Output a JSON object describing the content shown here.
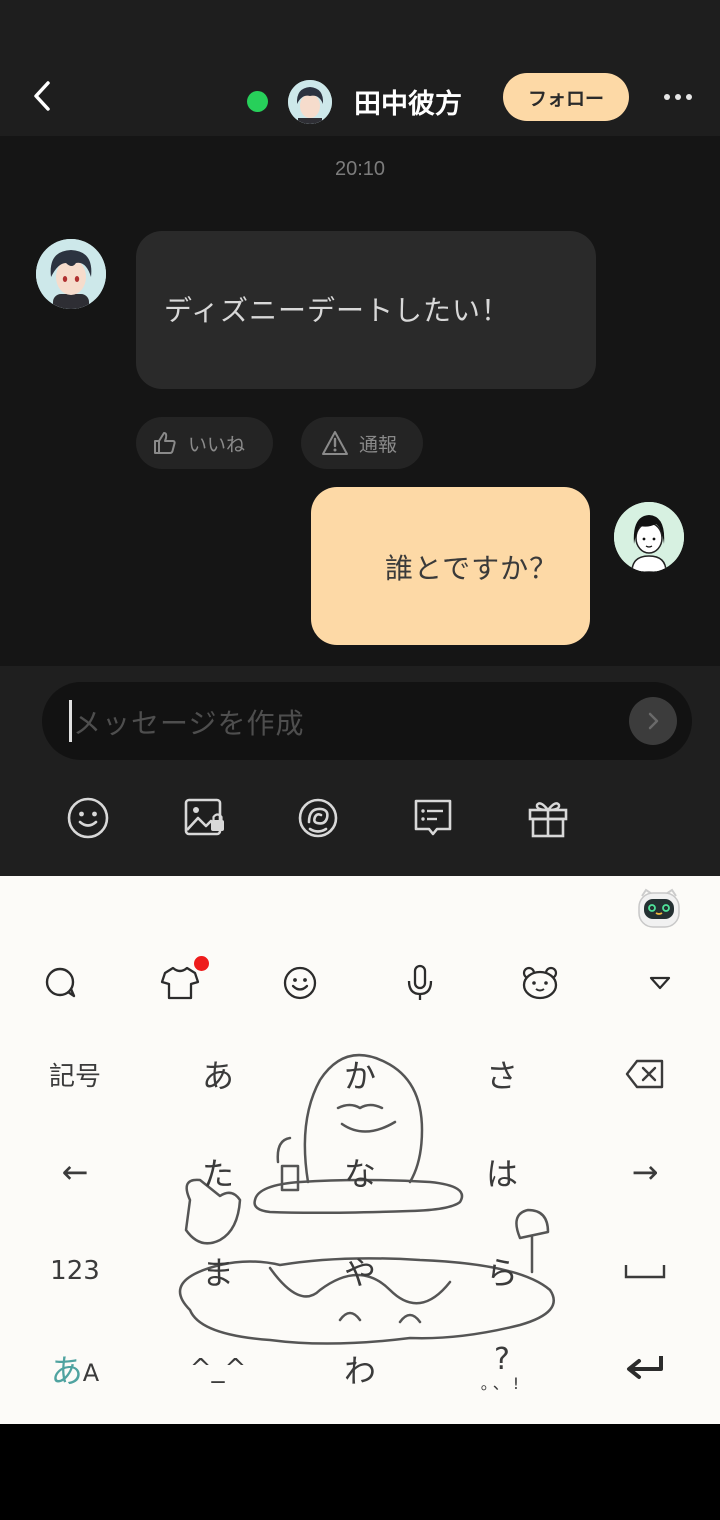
{
  "header": {
    "name": "田中彼方",
    "follow_label": "フォロー",
    "online_color": "#27d05a"
  },
  "chat": {
    "timestamp": "20:10",
    "incoming_message": "ディズニーデートしたい！",
    "like_label": "いいね",
    "report_label": "通報",
    "outgoing_message": "誰とですか？"
  },
  "composer": {
    "placeholder": "メッセージを作成",
    "tools": [
      "smile-icon",
      "image-lock-icon",
      "sticker-icon",
      "message-box-icon",
      "gift-icon"
    ]
  },
  "keyboard": {
    "toolbar": [
      "search-icon",
      "tshirt-icon",
      "emoji-icon",
      "mic-icon",
      "bear-icon",
      "collapse-icon"
    ],
    "keys": {
      "symbols": "記号",
      "a": "あ",
      "ka": "か",
      "sa": "さ",
      "left_arrow": "←",
      "ta": "た",
      "na": "な",
      "ha": "は",
      "right_arrow": "→",
      "num": "123",
      "ma": "ま",
      "ya": "や",
      "ra": "ら",
      "kana_mode": "あ",
      "kana_mode_sub": "A",
      "kaomoji": "^_^",
      "wa": "わ",
      "punct": "?",
      "punct_sub": "。、!"
    }
  },
  "colors": {
    "accent": "#fdd9a6",
    "background": "#151515"
  }
}
